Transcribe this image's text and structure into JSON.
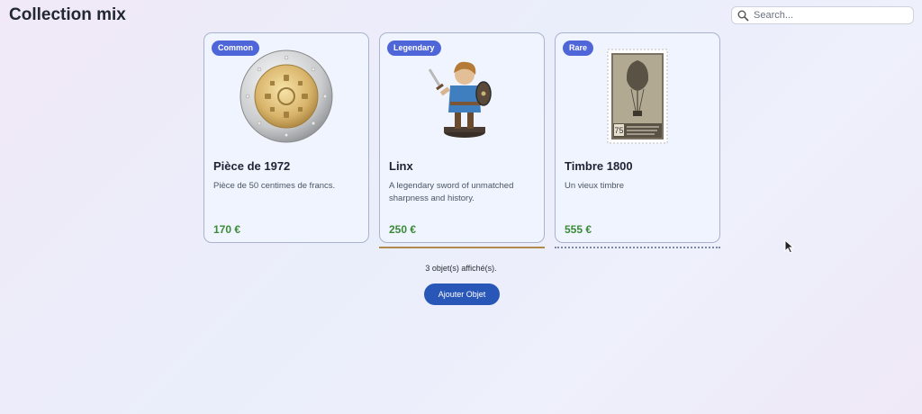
{
  "header": {
    "title": "Collection mix",
    "search_placeholder": "Search..."
  },
  "cards": [
    {
      "rarity": "Common",
      "image": "euro-coin-image",
      "title": "Pièce de 1972",
      "description": "Pièce de 50 centimes de francs.",
      "price": "170 €"
    },
    {
      "rarity": "Legendary",
      "image": "figurine-image",
      "title": "Linx",
      "description": "A legendary sword of unmatched sharpness and history.",
      "price": "250 €"
    },
    {
      "rarity": "Rare",
      "image": "stamp-image",
      "title": "Timbre 1800",
      "description": "Un vieux timbre",
      "price": "555 €"
    }
  ],
  "footer": {
    "count_text": "3 objet(s) affiché(s).",
    "add_button_label": "Ajouter Objet"
  },
  "colors": {
    "badge": "#4f66d9",
    "price": "#3a8a38",
    "button": "#2957b8"
  }
}
